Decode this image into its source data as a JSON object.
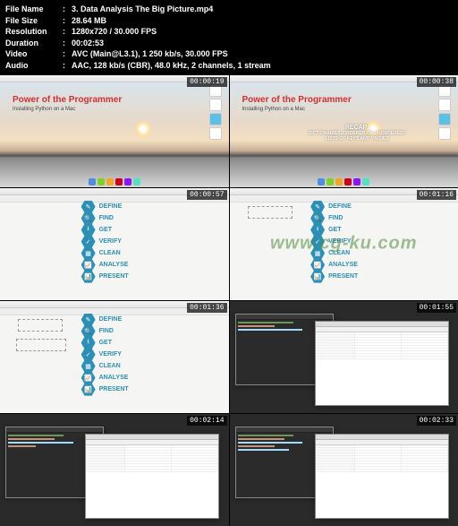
{
  "metadata": {
    "fileNameLabel": "File Name",
    "fileName": "3. Data Analysis The Big Picture.mp4",
    "fileSizeLabel": "File Size",
    "fileSize": "28.64 MB",
    "resolutionLabel": "Resolution",
    "resolution": "1280x720 / 30.000 FPS",
    "durationLabel": "Duration",
    "duration": "00:02:53",
    "videoLabel": "Video",
    "video": "AVC (Main@L3.1), 1 250 kb/s, 30.000 FPS",
    "audioLabel": "Audio",
    "audio": "AAC, 128 kb/s (CBR), 48.0 kHz, 2 channels, 1 stream"
  },
  "watermark": "www.cg-ku.com",
  "slides": {
    "title": "Power of the Programmer",
    "subtitle": "Installing Python on a Mac",
    "recapLabel": "RECAP:",
    "recapLine1": "DICTIONARIES, ORDERED OR UNORDERED?",
    "recapLine2": "LISTS OF KEYS AND VALUES"
  },
  "hexSteps": [
    {
      "icon": "✎",
      "label": "DEFINE"
    },
    {
      "icon": "🔍",
      "label": "FIND"
    },
    {
      "icon": "⭳",
      "label": "GET"
    },
    {
      "icon": "✓",
      "label": "VERIFY"
    },
    {
      "icon": "▦",
      "label": "CLEAN"
    },
    {
      "icon": "📈",
      "label": "ANALYSE"
    },
    {
      "icon": "📊",
      "label": "PRESENT"
    }
  ],
  "thumbnails": [
    {
      "timestamp": "00:00:19"
    },
    {
      "timestamp": "00:00:38"
    },
    {
      "timestamp": "00:00:57"
    },
    {
      "timestamp": "00:01:16"
    },
    {
      "timestamp": "00:01:36"
    },
    {
      "timestamp": "00:01:55"
    },
    {
      "timestamp": "00:02:14"
    },
    {
      "timestamp": "00:02:33"
    }
  ]
}
